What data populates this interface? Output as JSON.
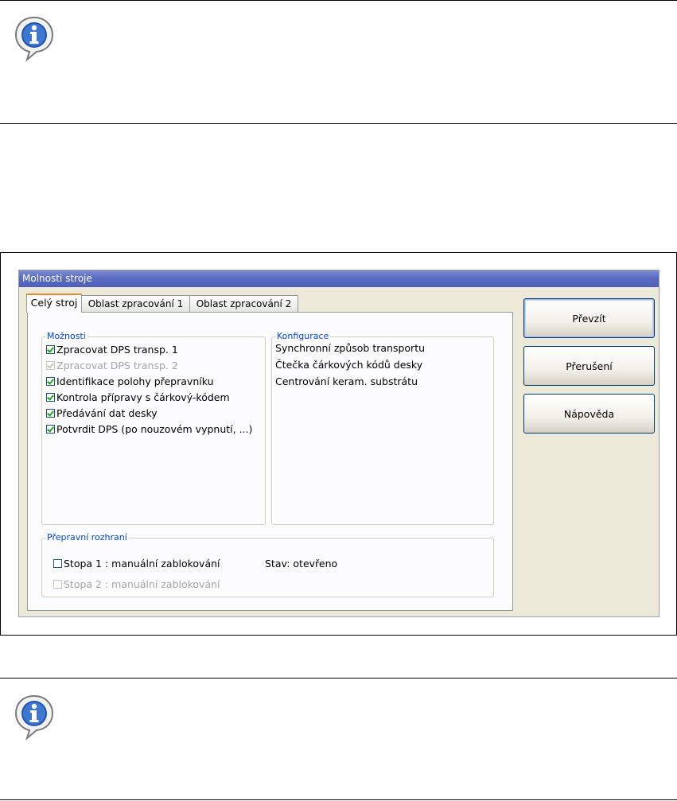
{
  "dialog": {
    "title": "Molnosti stroje",
    "tabs": [
      {
        "label": "Celý stroj"
      },
      {
        "label": "Oblast zpracování 1"
      },
      {
        "label": "Oblast zpracování 2"
      }
    ],
    "options_group": {
      "label": "Možnosti",
      "items": [
        {
          "label": "Zpracovat DPS transp. 1",
          "checked": true,
          "enabled": true
        },
        {
          "label": "Zpracovat DPS transp. 2",
          "checked": true,
          "enabled": false
        },
        {
          "label": "Identifikace polohy přepravníku",
          "checked": true,
          "enabled": true
        },
        {
          "label": "Kontrola přípravy s čárkový-kódem",
          "checked": true,
          "enabled": true
        },
        {
          "label": "Předávání dat desky",
          "checked": true,
          "enabled": true
        },
        {
          "label": "Potvrdit DPS (po nouzovém vypnutí, ...)",
          "checked": true,
          "enabled": true
        }
      ]
    },
    "config_group": {
      "label": "Konfigurace",
      "items": [
        "Synchronní způsob transportu",
        "Čtečka čárkových kódů desky",
        "Centrování keram. substrátu"
      ]
    },
    "transport_group": {
      "label": "Přepravní rozhraní",
      "lanes": [
        {
          "label": "Stopa 1 : manuální zablokování",
          "checked": false,
          "enabled": true
        },
        {
          "label": "Stopa 2 : manuální zablokování",
          "checked": false,
          "enabled": false
        }
      ],
      "status": "Stav: otevřeno"
    },
    "buttons": {
      "accept": "Převzít",
      "cancel": "Přerušení",
      "help": "Nápověda"
    }
  },
  "icons": [
    "info-icon",
    "info-icon"
  ]
}
